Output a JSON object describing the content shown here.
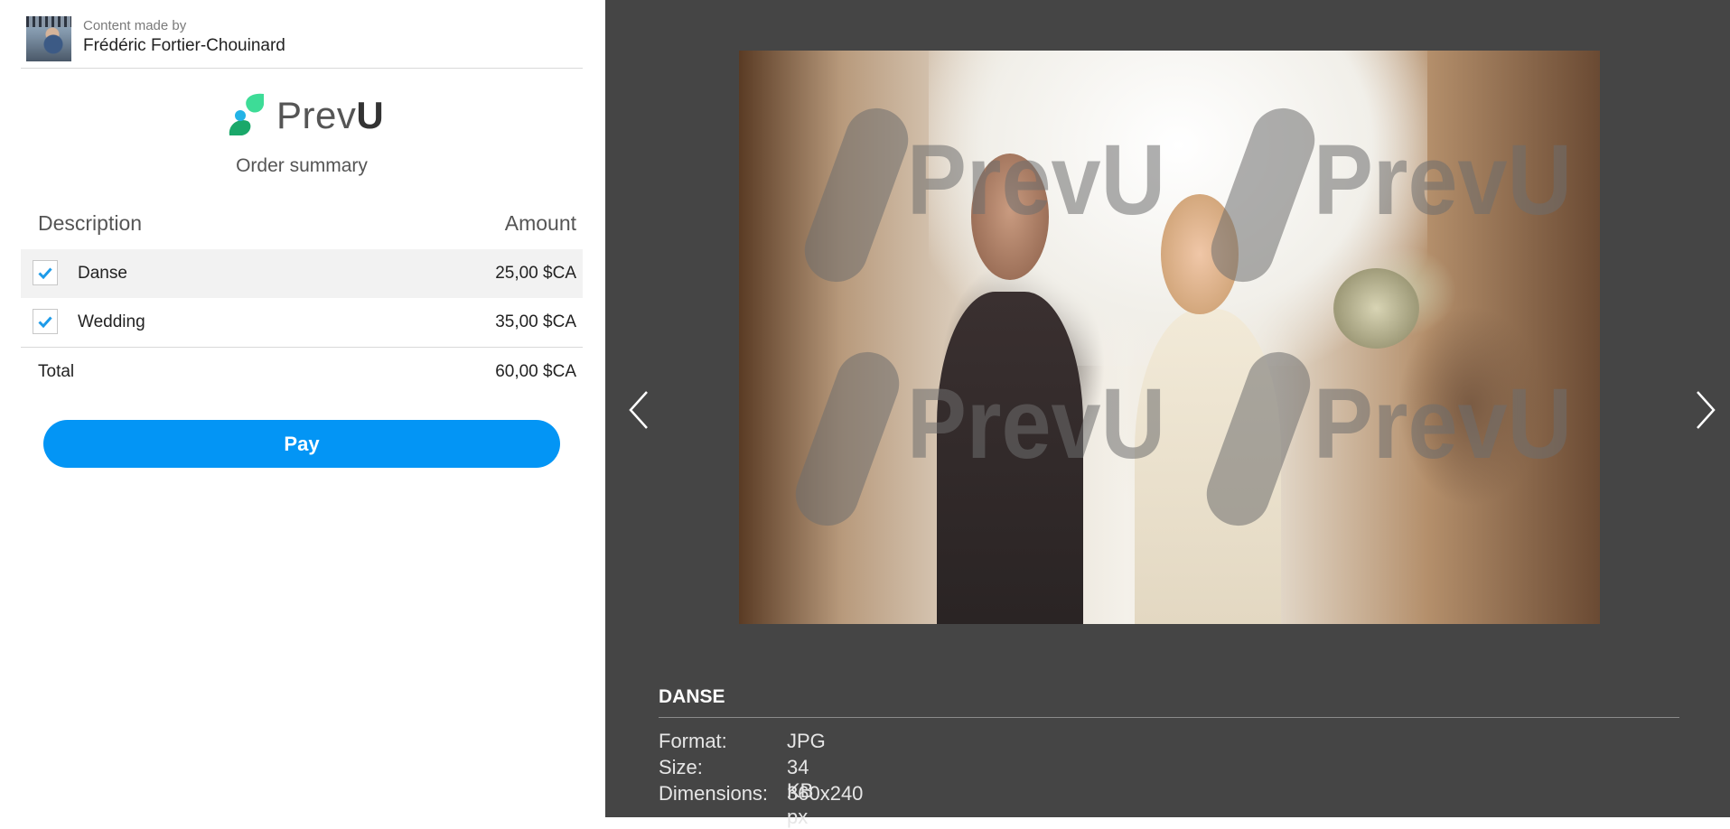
{
  "author": {
    "caption": "Content made by",
    "name": "Frédéric Fortier-Chouinard"
  },
  "brand": {
    "name_part1": "Prev",
    "name_part2": "U",
    "logo_colors": [
      "#3ddc97",
      "#1aa86a",
      "#23b3e6"
    ]
  },
  "order": {
    "title": "Order summary",
    "columns": {
      "description": "Description",
      "amount": "Amount"
    },
    "items": [
      {
        "label": "Danse",
        "amount": "25,00 $CA",
        "checked": true
      },
      {
        "label": "Wedding",
        "amount": "35,00 $CA",
        "checked": true
      }
    ],
    "total_label": "Total",
    "total_amount": "60,00 $CA",
    "pay_label": "Pay"
  },
  "viewer": {
    "watermark_text": "PrevU",
    "nav_prev_icon": "chevron-left-icon",
    "nav_next_icon": "chevron-right-icon",
    "image_title": "DANSE",
    "details": [
      {
        "key": "Format:",
        "value": "JPG"
      },
      {
        "key": "Size:",
        "value": "34 KB"
      },
      {
        "key": "Dimensions:",
        "value": "360x240 px"
      }
    ]
  },
  "colors": {
    "accent": "#0395f5",
    "viewer_background": "#454545",
    "check": "#1e9be9"
  }
}
